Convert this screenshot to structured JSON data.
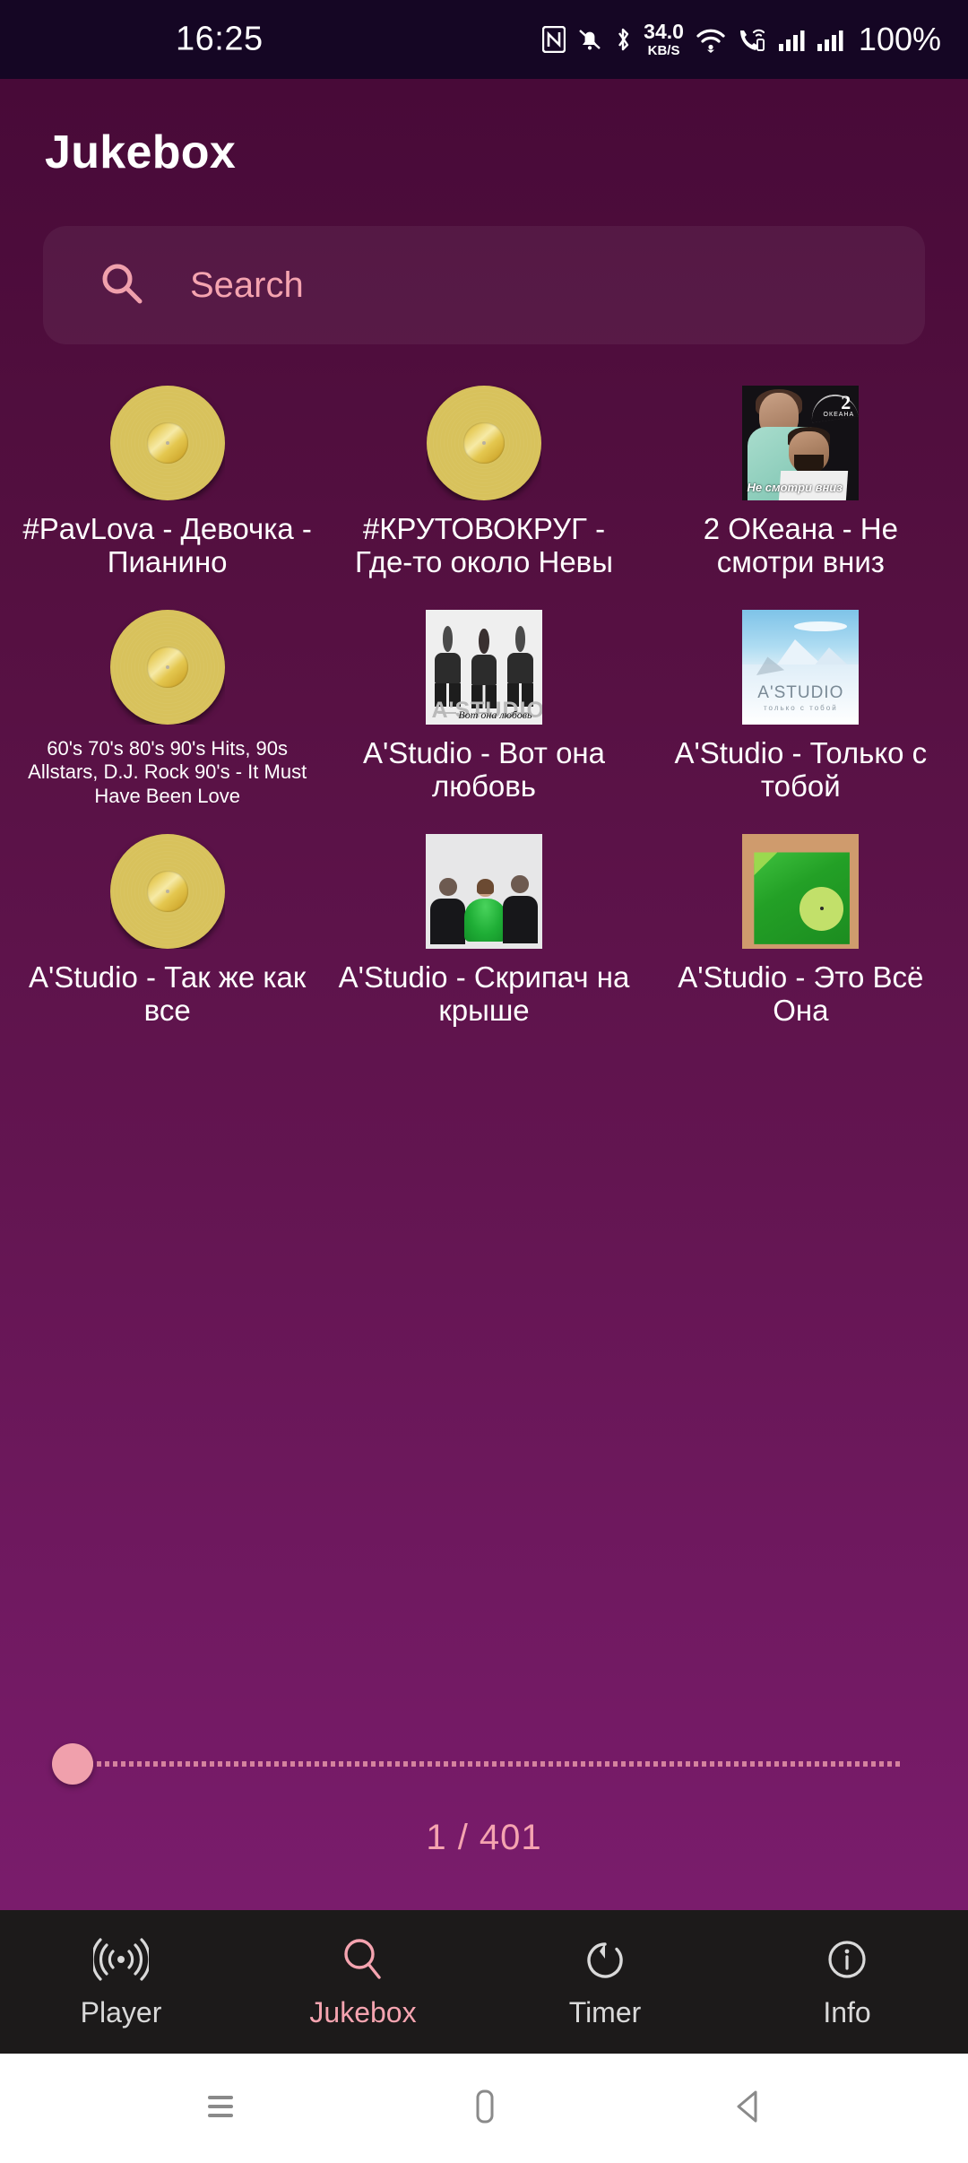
{
  "status_bar": {
    "time": "16:25",
    "network_speed_value": "34.0",
    "network_speed_unit": "KB/S",
    "battery": "100%",
    "icons": [
      "nfc-icon",
      "bell-muted-icon",
      "bluetooth-icon",
      "wifi-icon",
      "wifi-calling-icon",
      "signal-bars-icon",
      "signal-bars-icon"
    ]
  },
  "app": {
    "title": "Jukebox",
    "accent_pink": "#F5A4B0",
    "background_top": "#480A38",
    "background_bottom": "#7A1C6C"
  },
  "search": {
    "placeholder": "Search",
    "value": "",
    "icon": "search-icon"
  },
  "grid": {
    "items": [
      {
        "title": "#PavLova - Девочка - Пианино",
        "art": "vinyl-placeholder",
        "small": false
      },
      {
        "title": "#КРУТОВОКРУГ - Где-то около Невы",
        "art": "vinyl-placeholder",
        "small": false
      },
      {
        "title": "2 ОКеана - Не смотри вниз",
        "art": "cover-okeana",
        "small": false
      },
      {
        "title": "60's 70's 80's 90's Hits, 90s Allstars, D.J. Rock 90's - It Must Have Been Love",
        "art": "vinyl-placeholder",
        "small": true
      },
      {
        "title": "A'Studio - Вот она любовь",
        "art": "cover-vot-ona-lyubov",
        "small": false
      },
      {
        "title": "A'Studio - Только с тобой",
        "art": "cover-tolko-s-toboy",
        "small": false
      },
      {
        "title": "A'Studio - Так же как все",
        "art": "vinyl-placeholder",
        "small": false
      },
      {
        "title": "A'Studio - Скрипач на крыше",
        "art": "cover-skripach-na-kryshe",
        "small": false
      },
      {
        "title": "A'Studio - Это Всё Она",
        "art": "cover-eto-vsyo-ona",
        "small": false
      }
    ]
  },
  "artwork_text": {
    "okeana_logo": "2",
    "okeana_sub": "ОКЕАНА",
    "okeana_badge": "Не смотри вниз",
    "astudio_wordmark": "A'STUDIO",
    "vot_subtitle": "Вот она любовь",
    "mountain_subtitle": "только с тобой"
  },
  "pager": {
    "position_label": "1 / 401",
    "current": 1,
    "total": 401,
    "thumb_percent": 0
  },
  "bottom_nav": {
    "items": [
      {
        "label": "Player",
        "icon": "broadcast-icon",
        "active": false
      },
      {
        "label": "Jukebox",
        "icon": "search-icon",
        "active": true
      },
      {
        "label": "Timer",
        "icon": "timer-icon",
        "active": false
      },
      {
        "label": "Info",
        "icon": "info-icon",
        "active": false
      }
    ]
  },
  "android_nav": {
    "items": [
      "recents-icon",
      "home-icon",
      "back-icon"
    ]
  }
}
